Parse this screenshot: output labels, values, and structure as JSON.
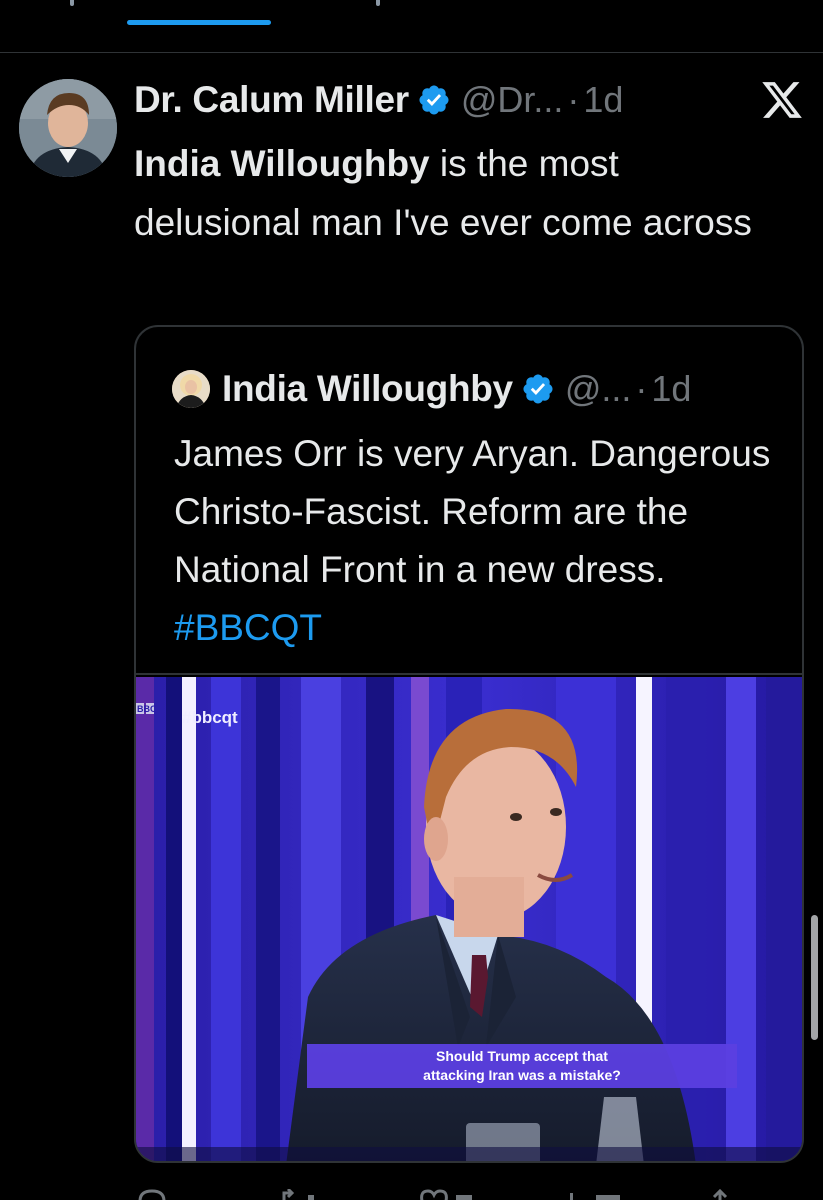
{
  "tweet": {
    "author_name": "Dr. Calum Miller",
    "handle": "@Dr...",
    "separator": "·",
    "time": "1d",
    "mention": "India Willoughby",
    "text_rest": " is the most delusional man I've ever come across",
    "quoted": {
      "author_name": "India Willoughby",
      "handle": "@...",
      "separator": "·",
      "time": "1d",
      "text": "James Orr is very Aryan. Dangerous Christo-Fascist. Reform are the National Front in a new dress. ",
      "hashtag": "#BBCQT",
      "media": {
        "channel_logo": "BBC",
        "overlay_hashtag": "#bbcqt",
        "caption_line1": "Should Trump accept that",
        "caption_line2": "attacking Iran was a mistake?"
      }
    }
  },
  "icons": {
    "verified": "verified-badge-icon",
    "close": "x-logo-icon"
  },
  "colors": {
    "background": "#000000",
    "text": "#e7e9ea",
    "secondary": "#71767b",
    "accent": "#1d9bf0",
    "border": "#2f3336"
  }
}
